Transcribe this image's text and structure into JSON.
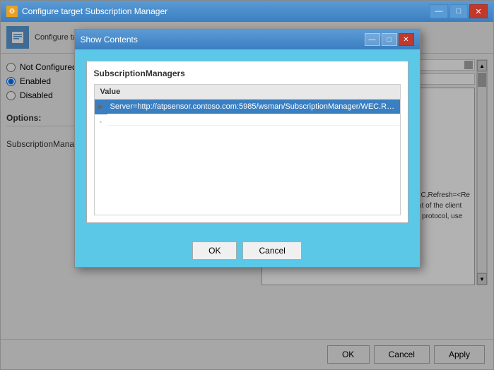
{
  "window": {
    "title": "Configure target Subscription Manager",
    "icon": "⚙"
  },
  "toolbar": {
    "configure_label": "Configure target Subscription Manager"
  },
  "radio_group": {
    "not_configured": "Not Configured",
    "enabled": "Enabled",
    "disabled": "Disabled",
    "enabled_checked": true
  },
  "options": {
    "label": "Options:",
    "subscription_managers_label": "SubscriptionManagers"
  },
  "description": {
    "text": "e server address,\n(CA) of a target\n\nigure the Source\nualified Domain\nspecifics.\n\nPS protocol:\n\nServer=https://<FQDN of the\ncollector>:5986/wsman/SubscriptionManager/WEC,Refresh=<Refresh interval in seconds>,IssuerCA=<Thumb print of the client authentication certificate>. When using the HTTP protocol, use"
  },
  "bottom_buttons": {
    "ok": "OK",
    "cancel": "Cancel",
    "apply": "Apply"
  },
  "modal": {
    "title": "Show Contents",
    "section_title": "SubscriptionManagers",
    "table_header": "Value",
    "rows": [
      {
        "value": "Server=http://atpsensor.contoso.com:5985/wsman/SubscriptionManager/WEC.Re...",
        "selected": true
      },
      {
        "value": "",
        "selected": false
      }
    ],
    "ok_label": "OK",
    "cancel_label": "Cancel"
  }
}
